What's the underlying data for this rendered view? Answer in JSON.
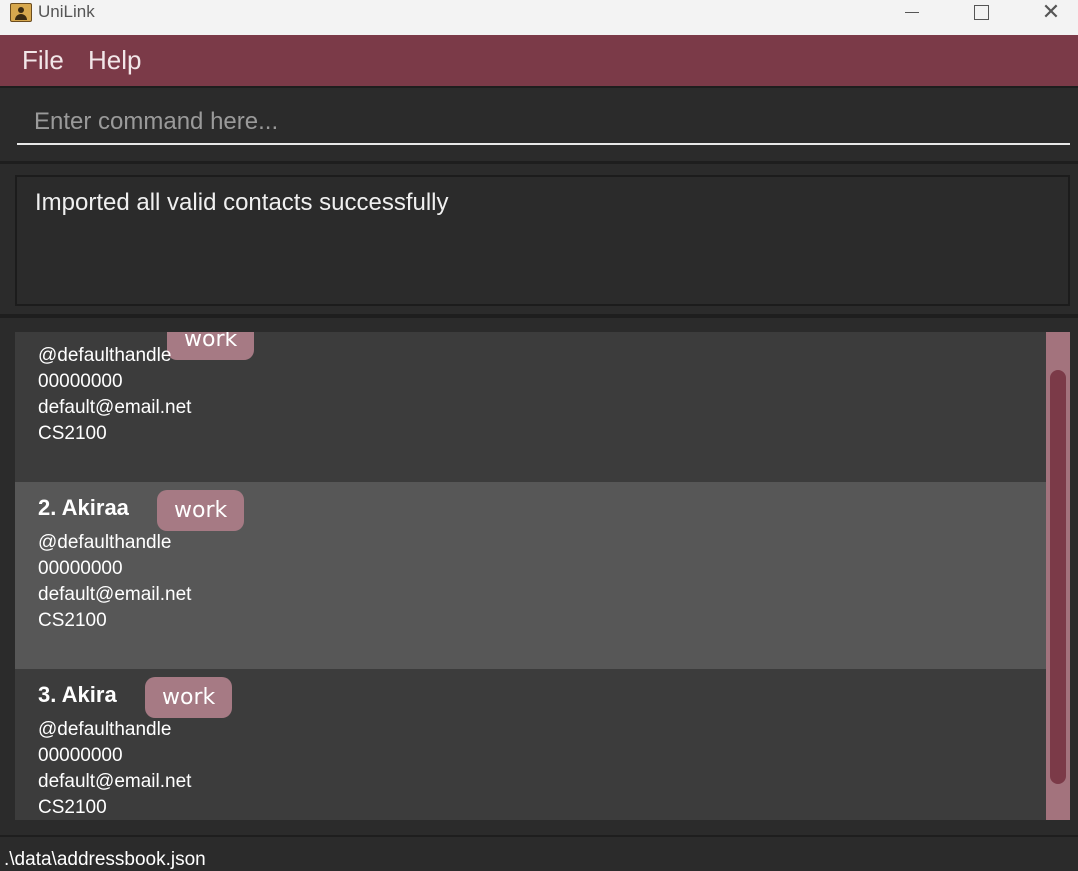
{
  "window": {
    "title": "UniLink"
  },
  "menu": {
    "file_label": "File",
    "help_label": "Help"
  },
  "command": {
    "placeholder": "Enter command here..."
  },
  "result": {
    "message": "Imported all valid contacts successfully"
  },
  "contacts": [
    {
      "name": "",
      "tag": "work",
      "handle": "@defaulthandle",
      "phone": "00000000",
      "email": "default@email.net",
      "module": "CS2100"
    },
    {
      "name": "2. Akiraa",
      "tag": "work",
      "handle": "@defaulthandle",
      "phone": "00000000",
      "email": "default@email.net",
      "module": "CS2100"
    },
    {
      "name": "3. Akira",
      "tag": "work",
      "handle": "@defaulthandle",
      "phone": "00000000",
      "email": "default@email.net",
      "module": "CS2100"
    }
  ],
  "status": {
    "file_path": ".\\data\\addressbook.json"
  },
  "colors": {
    "accent": "#7b3a48",
    "tag_bg": "#a67a84",
    "card_dark": "#3c3c3c",
    "card_light": "#575757"
  }
}
